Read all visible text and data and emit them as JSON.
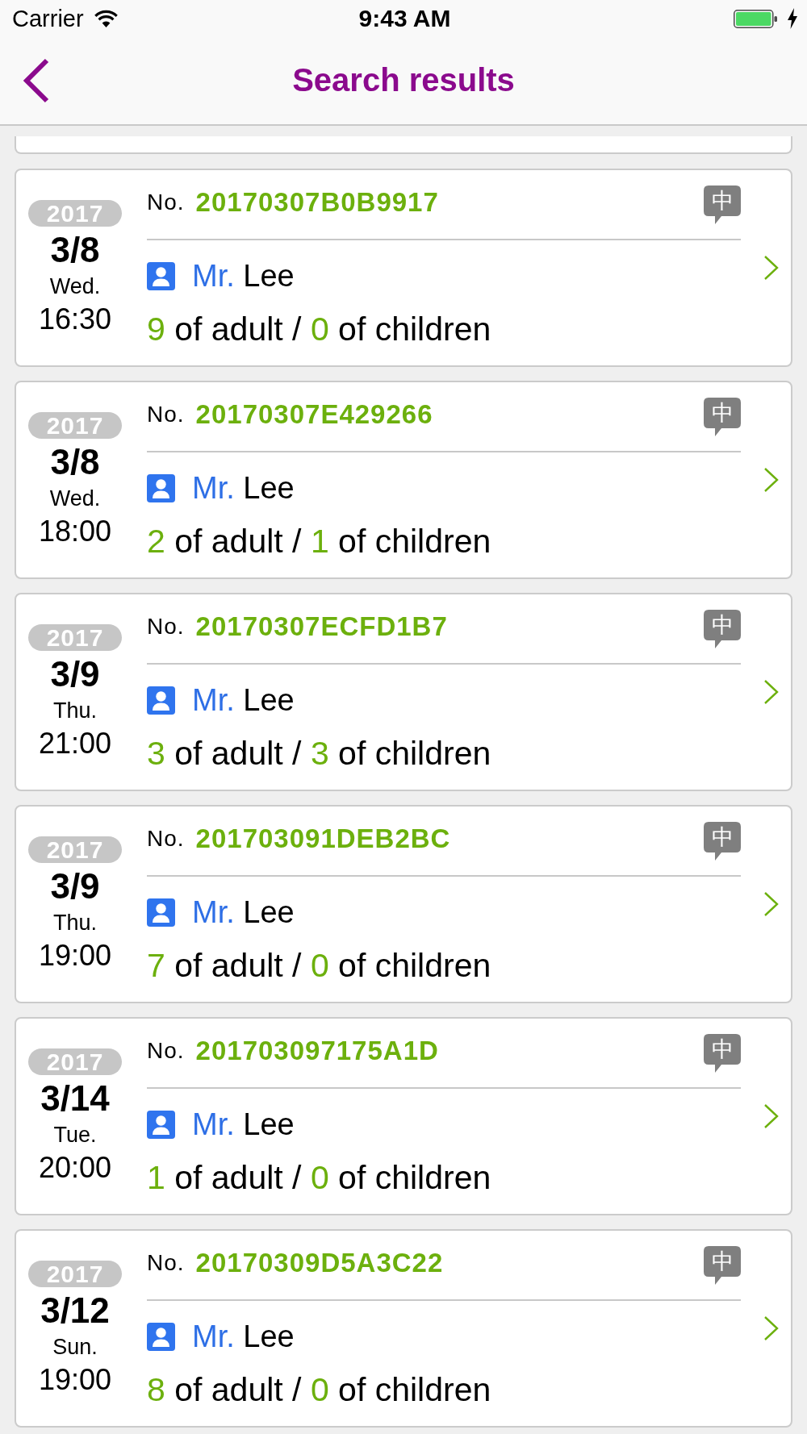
{
  "status_bar": {
    "carrier": "Carrier",
    "time": "9:43 AM"
  },
  "nav_bar": {
    "title": "Search results"
  },
  "results": [
    {
      "year": "2017",
      "date": "3/8",
      "weekday": "Wed.",
      "time": "16:30",
      "order_label": "No.",
      "order_no": "20170307B0B9917",
      "language_badge": "中",
      "salutation": "Mr.",
      "name": "Lee",
      "adults": "9",
      "adults_label": "of adult /",
      "children": "0",
      "children_label": "of children"
    },
    {
      "year": "2017",
      "date": "3/8",
      "weekday": "Wed.",
      "time": "18:00",
      "order_label": "No.",
      "order_no": "20170307E429266",
      "language_badge": "中",
      "salutation": "Mr.",
      "name": "Lee",
      "adults": "2",
      "adults_label": "of adult /",
      "children": "1",
      "children_label": "of children"
    },
    {
      "year": "2017",
      "date": "3/9",
      "weekday": "Thu.",
      "time": "21:00",
      "order_label": "No.",
      "order_no": "20170307ECFD1B7",
      "language_badge": "中",
      "salutation": "Mr.",
      "name": "Lee",
      "adults": "3",
      "adults_label": "of adult /",
      "children": "3",
      "children_label": "of children"
    },
    {
      "year": "2017",
      "date": "3/9",
      "weekday": "Thu.",
      "time": "19:00",
      "order_label": "No.",
      "order_no": "201703091DEB2BC",
      "language_badge": "中",
      "salutation": "Mr.",
      "name": "Lee",
      "adults": "7",
      "adults_label": "of adult /",
      "children": "0",
      "children_label": "of children"
    },
    {
      "year": "2017",
      "date": "3/14",
      "weekday": "Tue.",
      "time": "20:00",
      "order_label": "No.",
      "order_no": "201703097175A1D",
      "language_badge": "中",
      "salutation": "Mr.",
      "name": "Lee",
      "adults": "1",
      "adults_label": "of adult /",
      "children": "0",
      "children_label": "of children"
    },
    {
      "year": "2017",
      "date": "3/12",
      "weekday": "Sun.",
      "time": "19:00",
      "order_label": "No.",
      "order_no": "20170309D5A3C22",
      "language_badge": "中",
      "salutation": "Mr.",
      "name": "Lee",
      "adults": "8",
      "adults_label": "of adult /",
      "children": "0",
      "children_label": "of children"
    }
  ]
}
